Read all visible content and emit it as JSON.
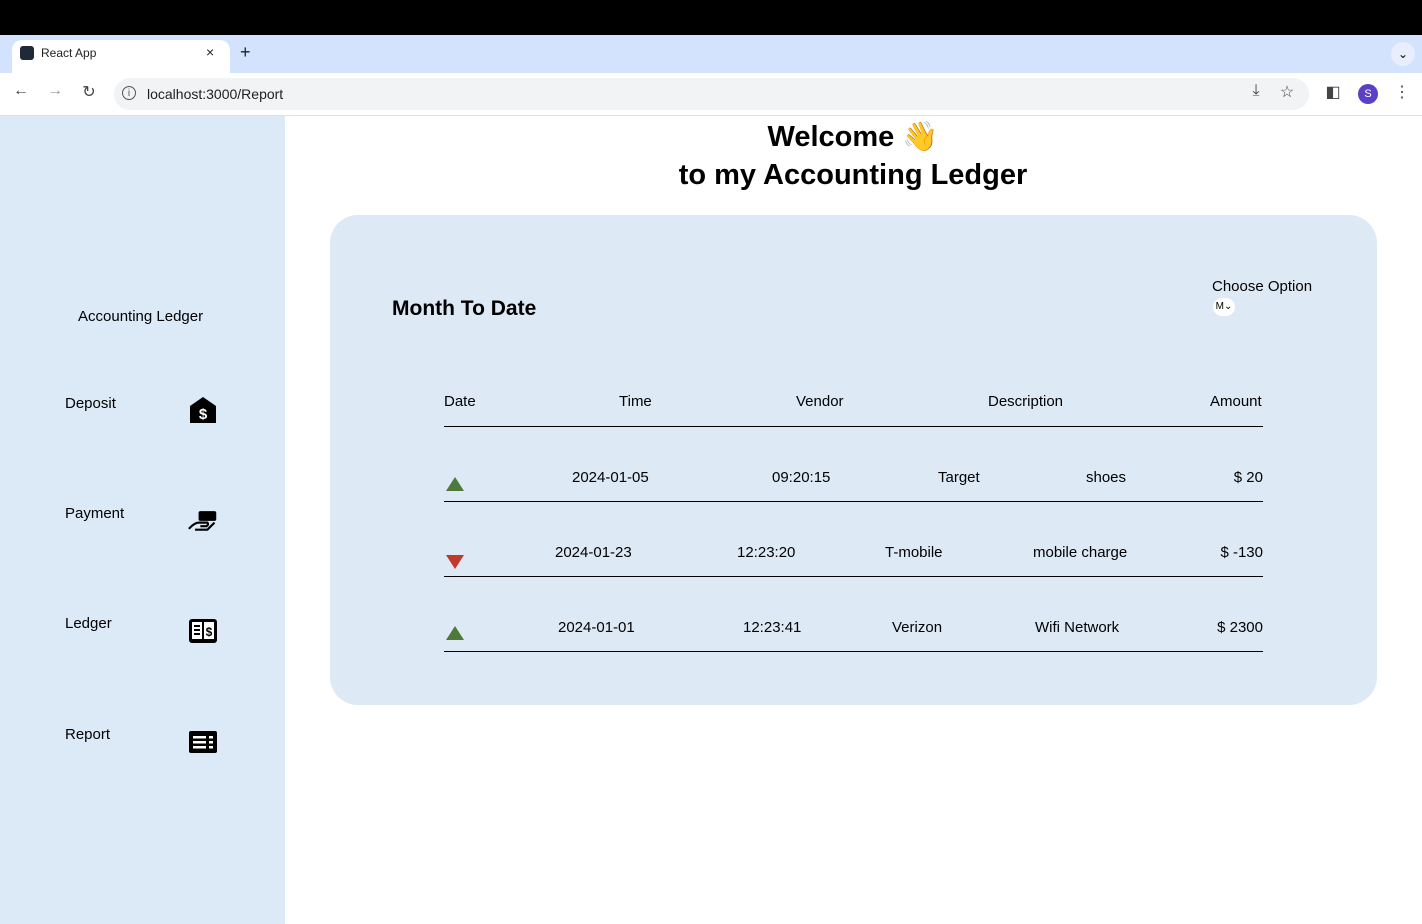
{
  "browser": {
    "tab_title": "React App",
    "tab_close": "×",
    "new_tab": "+",
    "url": "localhost:3000/Report",
    "avatar_initial": "S"
  },
  "sidebar": {
    "title": "Accounting Ledger",
    "items": [
      {
        "label": "Deposit",
        "icon": "deposit-icon"
      },
      {
        "label": "Payment",
        "icon": "payment-icon"
      },
      {
        "label": "Ledger",
        "icon": "ledger-icon"
      },
      {
        "label": "Report",
        "icon": "report-icon"
      }
    ]
  },
  "header": {
    "line1": "Welcome 👋",
    "line2": "to my Accounting Ledger"
  },
  "report": {
    "title": "Month To Date",
    "choose_label": "Choose Option",
    "choose_value": "M",
    "columns": [
      "Date",
      "Time",
      "Vendor",
      "Description",
      "Amount"
    ],
    "rows": [
      {
        "trend": "up",
        "date": "2024-01-05",
        "time": "09:20:15",
        "vendor": "Target",
        "description": "shoes",
        "amount": "$ 20"
      },
      {
        "trend": "down",
        "date": "2024-01-23",
        "time": "12:23:20",
        "vendor": "T-mobile",
        "description": "mobile charge",
        "amount": "$ -130"
      },
      {
        "trend": "up",
        "date": "2024-01-01",
        "time": "12:23:41",
        "vendor": "Verizon",
        "description": "Wifi Network",
        "amount": "$ 2300"
      }
    ]
  },
  "colors": {
    "sidebar_bg": "#dce9f6",
    "card_bg": "#dde9f5",
    "up": "#4d7a3a",
    "down": "#c0392b"
  }
}
